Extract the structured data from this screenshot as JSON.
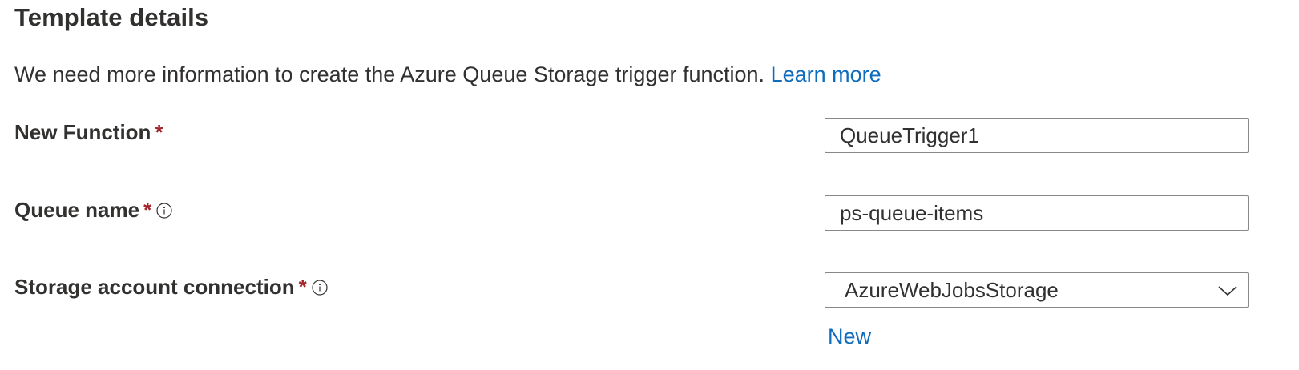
{
  "section": {
    "title": "Template details",
    "description": "We need more information to create the Azure Queue Storage trigger function.",
    "learn_more": "Learn more"
  },
  "fields": {
    "new_function": {
      "label": "New Function",
      "required_mark": "*",
      "value": "QueueTrigger1"
    },
    "queue_name": {
      "label": "Queue name",
      "required_mark": "*",
      "value": "ps-queue-items"
    },
    "storage_connection": {
      "label": "Storage account connection",
      "required_mark": "*",
      "selected": "AzureWebJobsStorage",
      "new_link": "New"
    }
  },
  "colors": {
    "link": "#0f6cbd",
    "required": "#a4262c",
    "text": "#323130",
    "border": "#8a8886"
  },
  "icons": {
    "info": "info-icon",
    "dropdown": "chevron-down-icon"
  }
}
